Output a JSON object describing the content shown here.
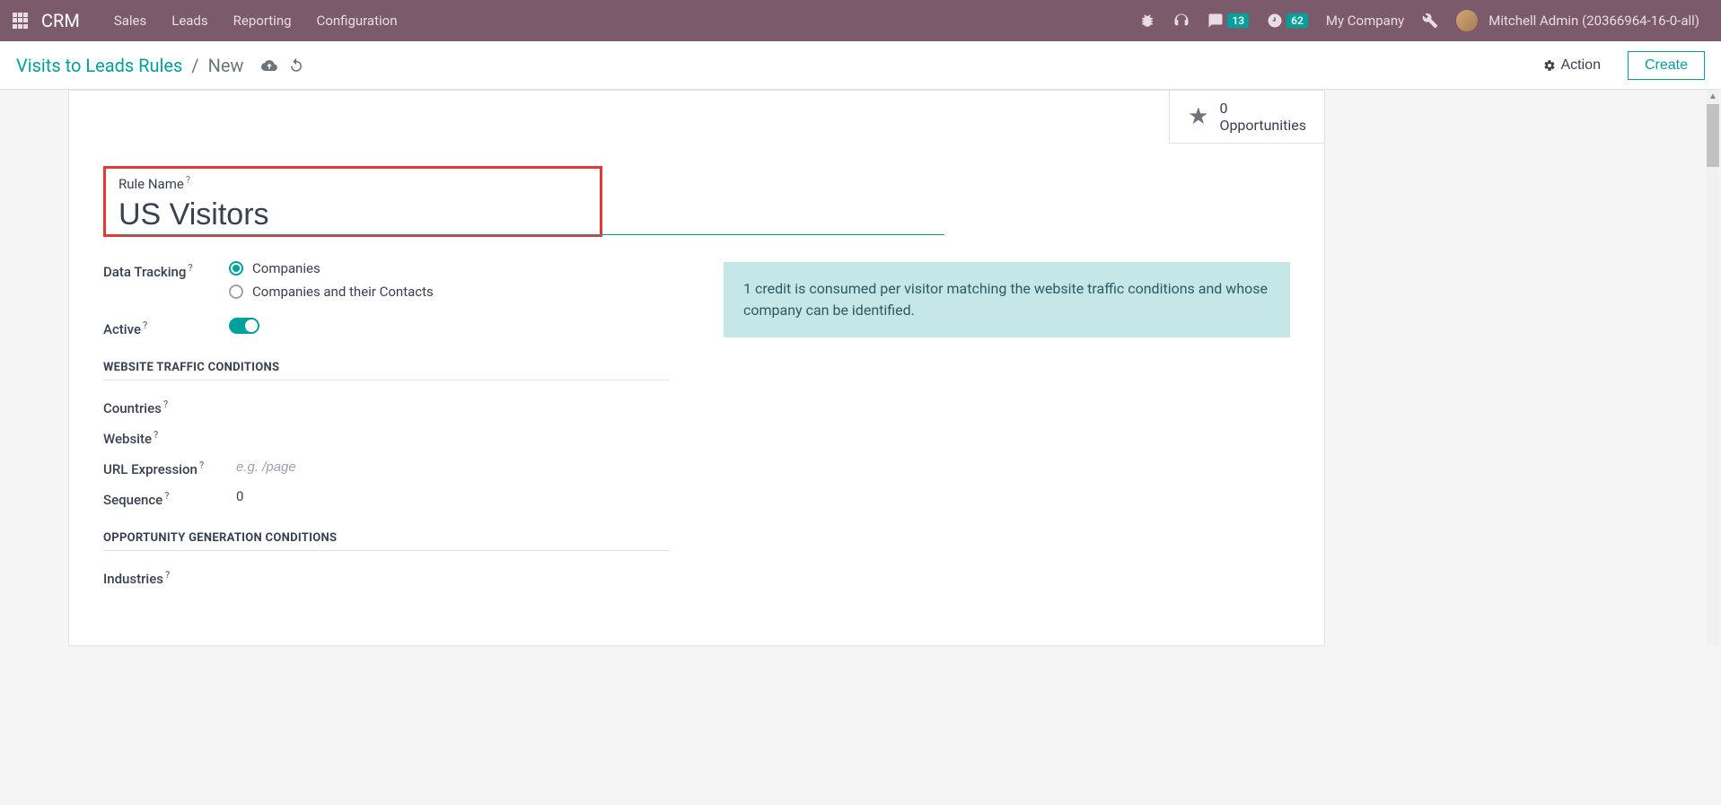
{
  "navbar": {
    "brand": "CRM",
    "menu": [
      "Sales",
      "Leads",
      "Reporting",
      "Configuration"
    ],
    "messages_badge": "13",
    "activities_badge": "62",
    "company": "My Company",
    "user": "Mitchell Admin (20366964-16-0-all)"
  },
  "controlbar": {
    "breadcrumb_link": "Visits to Leads Rules",
    "breadcrumb_current": "New",
    "action_label": "Action",
    "create_label": "Create"
  },
  "statbox": {
    "count": "0",
    "label": "Opportunities"
  },
  "form": {
    "rule_name_label": "Rule Name",
    "rule_name_value": "US Visitors",
    "data_tracking_label": "Data Tracking",
    "radio_companies": "Companies",
    "radio_companies_contacts": "Companies and their Contacts",
    "active_label": "Active",
    "info_text": "1 credit is consumed per visitor matching the website traffic conditions and whose company can be identified.",
    "section_traffic": "WEBSITE TRAFFIC CONDITIONS",
    "countries_label": "Countries",
    "website_label": "Website",
    "url_expression_label": "URL Expression",
    "url_placeholder": "e.g. /page",
    "sequence_label": "Sequence",
    "sequence_value": "0",
    "section_opportunity": "OPPORTUNITY GENERATION CONDITIONS",
    "industries_label": "Industries"
  }
}
